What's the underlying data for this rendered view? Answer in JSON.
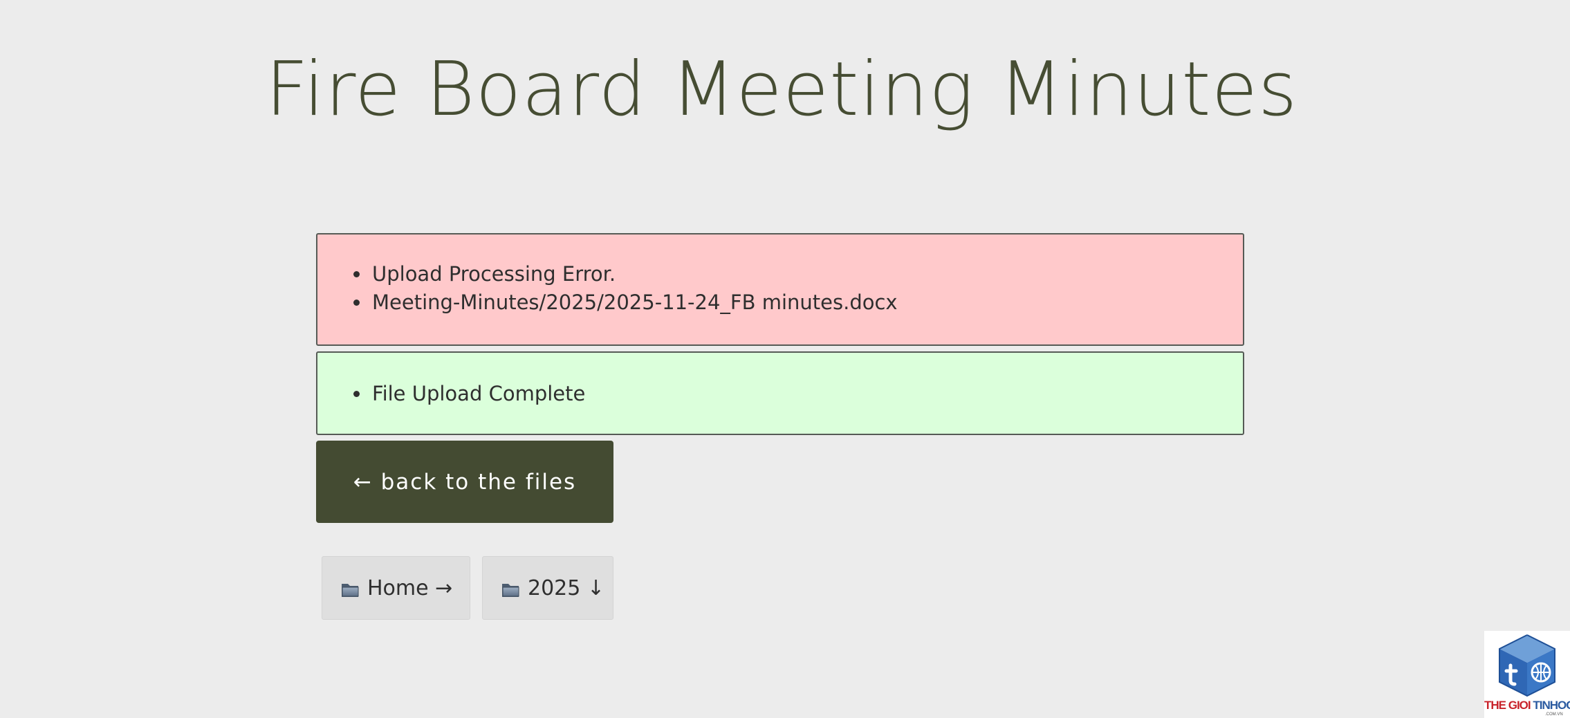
{
  "page": {
    "title": "Fire Board Meeting Minutes"
  },
  "alerts": {
    "error": {
      "items": [
        "Upload Processing Error.",
        "Meeting-Minutes/2025/2025-11-24_FB minutes.docx"
      ],
      "color": "#ffc9cb"
    },
    "success": {
      "items": [
        "File Upload Complete"
      ],
      "color": "#dbffdb"
    }
  },
  "back_button": {
    "label": "← back to the files"
  },
  "breadcrumbs": [
    {
      "label": "Home →",
      "icon": "folder-icon"
    },
    {
      "label": "2025 ↓",
      "icon": "folder-icon"
    }
  ],
  "watermark": {
    "brand_part1": "THE GIOI ",
    "brand_part2": "TINHOC",
    "sub": ".COM.VN"
  },
  "colors": {
    "accent": "#444b32",
    "title": "#464d33",
    "background": "#ececec"
  }
}
